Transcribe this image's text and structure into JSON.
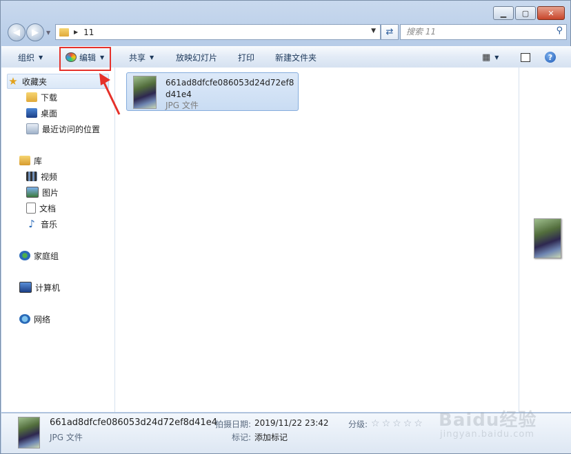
{
  "window": {
    "controls": {
      "minimize": "▁",
      "maximize": "▢",
      "close": "✕"
    }
  },
  "address": {
    "back_icon": "back-arrow-icon",
    "forward_icon": "forward-arrow-icon",
    "path": "11",
    "search_placeholder": "搜索 11"
  },
  "toolbar": {
    "organize": "组织",
    "edit": "编辑",
    "share": "共享",
    "slideshow": "放映幻灯片",
    "print": "打印",
    "new_folder": "新建文件夹",
    "help": "?"
  },
  "sidebar": {
    "favorites": {
      "label": "收藏夹",
      "items": [
        "下载",
        "桌面",
        "最近访问的位置"
      ]
    },
    "library": {
      "label": "库",
      "items": [
        "视频",
        "图片",
        "文档",
        "音乐"
      ]
    },
    "homegroup": "家庭组",
    "computer": "计算机",
    "network": "网络"
  },
  "files": [
    {
      "name": "661ad8dfcfe086053d24d72ef8d41e4",
      "type": "JPG 文件"
    }
  ],
  "details": {
    "name": "661ad8dfcfe086053d24d72ef8d41e4",
    "type": "JPG 文件",
    "date_label": "拍摄日期:",
    "date_value": "2019/11/22 23:42",
    "tags_label": "标记:",
    "tags_value": "添加标记",
    "rating_label": "分级:",
    "rating_value": "0 of 5"
  },
  "watermark": {
    "line1": "Baidu经验",
    "line2": "jingyan.baidu.com"
  },
  "colors": {
    "accent": "#84acdd",
    "annotation": "#e5312a"
  }
}
